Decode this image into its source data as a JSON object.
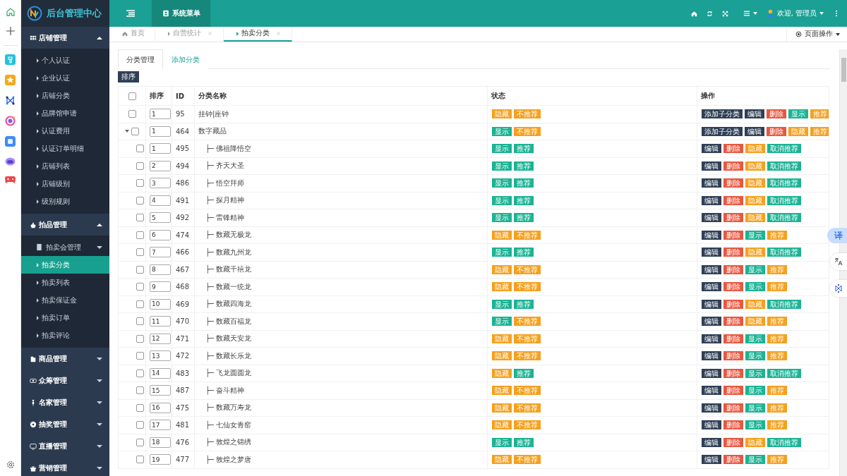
{
  "brand": {
    "title": "后台管理中心"
  },
  "topbar": {
    "menu_tab": "系统菜单",
    "user": "欢迎, 管理员"
  },
  "page_tabs": [
    {
      "label": "首页",
      "selected": false,
      "closable": false
    },
    {
      "label": "自营统计",
      "selected": false,
      "closable": true
    },
    {
      "label": "拍卖分类",
      "selected": true,
      "closable": true
    }
  ],
  "page_actions": "页面操作",
  "sidebar": {
    "groups": [
      {
        "label": "店铺管理",
        "expanded": true,
        "children": [
          {
            "label": "个人认证",
            "selected": false
          },
          {
            "label": "企业认证",
            "selected": false
          },
          {
            "label": "店铺分类",
            "selected": false
          },
          {
            "label": "品牌馆申请",
            "selected": false
          },
          {
            "label": "认证费用",
            "selected": false
          },
          {
            "label": "认证订单明细",
            "selected": false
          },
          {
            "label": "店铺列表",
            "selected": false
          },
          {
            "label": "店铺级别",
            "selected": false
          },
          {
            "label": "级别规则",
            "selected": false
          }
        ]
      },
      {
        "label": "拍品管理",
        "expanded": true,
        "children": [
          {
            "label": "拍卖会管理",
            "expanded": true,
            "children": [
              {
                "label": "拍卖分类",
                "selected": true
              },
              {
                "label": "拍卖列表",
                "selected": false
              },
              {
                "label": "拍卖保证金",
                "selected": false
              },
              {
                "label": "拍卖订单",
                "selected": false
              },
              {
                "label": "拍卖评论",
                "selected": false
              }
            ]
          }
        ]
      },
      {
        "label": "商品管理",
        "expanded": false
      },
      {
        "label": "众筹管理",
        "expanded": false
      },
      {
        "label": "名家管理",
        "expanded": false
      },
      {
        "label": "抽奖管理",
        "expanded": false
      },
      {
        "label": "直播管理",
        "expanded": false
      },
      {
        "label": "营销管理",
        "expanded": false
      }
    ]
  },
  "content": {
    "tabs": [
      {
        "label": "分类管理",
        "selected": true
      },
      {
        "label": "添加分类",
        "selected": false
      }
    ],
    "sort_button": "排序",
    "table": {
      "columns": [
        "排序",
        "ID",
        "分类名称",
        "状态",
        "操作"
      ],
      "select_all": {
        "checked": false
      },
      "rows": [
        {
          "checked": false,
          "sort": "1",
          "id": "95",
          "name": "挂钟|座钟",
          "status": [
            {
              "label": "隐藏",
              "kind": "warning"
            },
            {
              "label": "不推荐",
              "kind": "warning"
            }
          ],
          "actions": [
            {
              "label": "添加子分类",
              "kind": "dark"
            },
            {
              "label": "编辑",
              "kind": "dark"
            },
            {
              "label": "删除",
              "kind": "danger"
            },
            {
              "label": "显示",
              "kind": "success"
            },
            {
              "label": "推荐",
              "kind": "warning"
            }
          ]
        },
        {
          "checked": false,
          "sort": "1",
          "id": "464",
          "name": "数字藏品",
          "expanded": true,
          "status": [
            {
              "label": "显示",
              "kind": "success"
            },
            {
              "label": "不推荐",
              "kind": "warning"
            }
          ],
          "actions": [
            {
              "label": "添加子分类",
              "kind": "dark"
            },
            {
              "label": "编辑",
              "kind": "dark"
            },
            {
              "label": "删除",
              "kind": "danger"
            },
            {
              "label": "隐藏",
              "kind": "warning"
            },
            {
              "label": "推荐",
              "kind": "warning"
            }
          ],
          "children": [
            {
              "checked": false,
              "sort": "1",
              "id": "495",
              "name": "├─ 佛祖降悟空",
              "status": [
                {
                  "label": "显示",
                  "kind": "success"
                },
                {
                  "label": "推荐",
                  "kind": "success"
                }
              ],
              "actions": [
                {
                  "label": "编辑",
                  "kind": "dark"
                },
                {
                  "label": "删除",
                  "kind": "danger"
                },
                {
                  "label": "隐藏",
                  "kind": "warning"
                },
                {
                  "label": "取消推荐",
                  "kind": "success"
                }
              ]
            },
            {
              "checked": false,
              "sort": "2",
              "id": "494",
              "name": "├─ 齐天大圣",
              "status": [
                {
                  "label": "显示",
                  "kind": "success"
                },
                {
                  "label": "推荐",
                  "kind": "success"
                }
              ],
              "actions": [
                {
                  "label": "编辑",
                  "kind": "dark"
                },
                {
                  "label": "删除",
                  "kind": "danger"
                },
                {
                  "label": "隐藏",
                  "kind": "warning"
                },
                {
                  "label": "取消推荐",
                  "kind": "success"
                }
              ]
            },
            {
              "checked": false,
              "sort": "3",
              "id": "486",
              "name": "├─ 悟空拜师",
              "status": [
                {
                  "label": "显示",
                  "kind": "success"
                },
                {
                  "label": "推荐",
                  "kind": "success"
                }
              ],
              "actions": [
                {
                  "label": "编辑",
                  "kind": "dark"
                },
                {
                  "label": "删除",
                  "kind": "danger"
                },
                {
                  "label": "隐藏",
                  "kind": "warning"
                },
                {
                  "label": "取消推荐",
                  "kind": "success"
                }
              ]
            },
            {
              "checked": false,
              "sort": "4",
              "id": "491",
              "name": "├─ 探月精神",
              "status": [
                {
                  "label": "显示",
                  "kind": "success"
                },
                {
                  "label": "推荐",
                  "kind": "success"
                }
              ],
              "actions": [
                {
                  "label": "编辑",
                  "kind": "dark"
                },
                {
                  "label": "删除",
                  "kind": "danger"
                },
                {
                  "label": "隐藏",
                  "kind": "warning"
                },
                {
                  "label": "取消推荐",
                  "kind": "success"
                }
              ]
            },
            {
              "checked": false,
              "sort": "5",
              "id": "492",
              "name": "├─ 雷锋精神",
              "status": [
                {
                  "label": "显示",
                  "kind": "success"
                },
                {
                  "label": "推荐",
                  "kind": "success"
                }
              ],
              "actions": [
                {
                  "label": "编辑",
                  "kind": "dark"
                },
                {
                  "label": "删除",
                  "kind": "danger"
                },
                {
                  "label": "隐藏",
                  "kind": "warning"
                },
                {
                  "label": "取消推荐",
                  "kind": "success"
                }
              ]
            },
            {
              "checked": false,
              "sort": "6",
              "id": "474",
              "name": "├─ 数藏无极龙",
              "status": [
                {
                  "label": "隐藏",
                  "kind": "warning"
                },
                {
                  "label": "不推荐",
                  "kind": "warning"
                }
              ],
              "actions": [
                {
                  "label": "编辑",
                  "kind": "dark"
                },
                {
                  "label": "删除",
                  "kind": "danger"
                },
                {
                  "label": "显示",
                  "kind": "success"
                },
                {
                  "label": "推荐",
                  "kind": "warning"
                }
              ]
            },
            {
              "checked": false,
              "sort": "7",
              "id": "466",
              "name": "├─ 数藏九州龙",
              "status": [
                {
                  "label": "显示",
                  "kind": "success"
                },
                {
                  "label": "推荐",
                  "kind": "success"
                }
              ],
              "actions": [
                {
                  "label": "编辑",
                  "kind": "dark"
                },
                {
                  "label": "删除",
                  "kind": "danger"
                },
                {
                  "label": "隐藏",
                  "kind": "warning"
                },
                {
                  "label": "取消推荐",
                  "kind": "success"
                }
              ]
            },
            {
              "checked": false,
              "sort": "8",
              "id": "467",
              "name": "├─ 数藏千禧龙",
              "status": [
                {
                  "label": "隐藏",
                  "kind": "warning"
                },
                {
                  "label": "不推荐",
                  "kind": "warning"
                }
              ],
              "actions": [
                {
                  "label": "编辑",
                  "kind": "dark"
                },
                {
                  "label": "删除",
                  "kind": "danger"
                },
                {
                  "label": "显示",
                  "kind": "success"
                },
                {
                  "label": "推荐",
                  "kind": "warning"
                }
              ]
            },
            {
              "checked": false,
              "sort": "9",
              "id": "468",
              "name": "├─ 数藏一统龙",
              "status": [
                {
                  "label": "隐藏",
                  "kind": "warning"
                },
                {
                  "label": "不推荐",
                  "kind": "warning"
                }
              ],
              "actions": [
                {
                  "label": "编辑",
                  "kind": "dark"
                },
                {
                  "label": "删除",
                  "kind": "danger"
                },
                {
                  "label": "显示",
                  "kind": "success"
                },
                {
                  "label": "推荐",
                  "kind": "warning"
                }
              ]
            },
            {
              "checked": false,
              "sort": "10",
              "id": "469",
              "name": "├─ 数藏四海龙",
              "status": [
                {
                  "label": "显示",
                  "kind": "success"
                },
                {
                  "label": "推荐",
                  "kind": "success"
                }
              ],
              "actions": [
                {
                  "label": "编辑",
                  "kind": "dark"
                },
                {
                  "label": "删除",
                  "kind": "danger"
                },
                {
                  "label": "隐藏",
                  "kind": "warning"
                },
                {
                  "label": "取消推荐",
                  "kind": "success"
                }
              ]
            },
            {
              "checked": false,
              "sort": "11",
              "id": "470",
              "name": "├─ 数藏百福龙",
              "status": [
                {
                  "label": "显示",
                  "kind": "success"
                },
                {
                  "label": "不推荐",
                  "kind": "warning"
                }
              ],
              "actions": [
                {
                  "label": "编辑",
                  "kind": "dark"
                },
                {
                  "label": "删除",
                  "kind": "danger"
                },
                {
                  "label": "隐藏",
                  "kind": "warning"
                },
                {
                  "label": "推荐",
                  "kind": "warning"
                }
              ]
            },
            {
              "checked": false,
              "sort": "12",
              "id": "471",
              "name": "├─ 数藏天安龙",
              "status": [
                {
                  "label": "隐藏",
                  "kind": "warning"
                },
                {
                  "label": "不推荐",
                  "kind": "warning"
                }
              ],
              "actions": [
                {
                  "label": "编辑",
                  "kind": "dark"
                },
                {
                  "label": "删除",
                  "kind": "danger"
                },
                {
                  "label": "显示",
                  "kind": "success"
                },
                {
                  "label": "推荐",
                  "kind": "warning"
                }
              ]
            },
            {
              "checked": false,
              "sort": "13",
              "id": "472",
              "name": "├─ 数藏长乐龙",
              "status": [
                {
                  "label": "隐藏",
                  "kind": "warning"
                },
                {
                  "label": "不推荐",
                  "kind": "warning"
                }
              ],
              "actions": [
                {
                  "label": "编辑",
                  "kind": "dark"
                },
                {
                  "label": "删除",
                  "kind": "danger"
                },
                {
                  "label": "显示",
                  "kind": "success"
                },
                {
                  "label": "推荐",
                  "kind": "warning"
                }
              ]
            },
            {
              "checked": false,
              "sort": "14",
              "id": "483",
              "name": "├─ 飞龙圆圆龙",
              "status": [
                {
                  "label": "隐藏",
                  "kind": "warning"
                },
                {
                  "label": "推荐",
                  "kind": "success"
                }
              ],
              "actions": [
                {
                  "label": "编辑",
                  "kind": "dark"
                },
                {
                  "label": "删除",
                  "kind": "danger"
                },
                {
                  "label": "显示",
                  "kind": "success"
                },
                {
                  "label": "取消推荐",
                  "kind": "success"
                }
              ]
            },
            {
              "checked": false,
              "sort": "15",
              "id": "487",
              "name": "├─ 奋斗精神",
              "status": [
                {
                  "label": "隐藏",
                  "kind": "warning"
                },
                {
                  "label": "不推荐",
                  "kind": "warning"
                }
              ],
              "actions": [
                {
                  "label": "编辑",
                  "kind": "dark"
                },
                {
                  "label": "删除",
                  "kind": "danger"
                },
                {
                  "label": "显示",
                  "kind": "success"
                },
                {
                  "label": "推荐",
                  "kind": "warning"
                }
              ]
            },
            {
              "checked": false,
              "sort": "16",
              "id": "475",
              "name": "├─ 数藏万寿龙",
              "status": [
                {
                  "label": "隐藏",
                  "kind": "warning"
                },
                {
                  "label": "不推荐",
                  "kind": "warning"
                }
              ],
              "actions": [
                {
                  "label": "编辑",
                  "kind": "dark"
                },
                {
                  "label": "删除",
                  "kind": "danger"
                },
                {
                  "label": "显示",
                  "kind": "success"
                },
                {
                  "label": "推荐",
                  "kind": "warning"
                }
              ]
            },
            {
              "checked": false,
              "sort": "17",
              "id": "481",
              "name": "├─ 七仙女青窑",
              "status": [
                {
                  "label": "隐藏",
                  "kind": "warning"
                },
                {
                  "label": "不推荐",
                  "kind": "warning"
                }
              ],
              "actions": [
                {
                  "label": "编辑",
                  "kind": "dark"
                },
                {
                  "label": "删除",
                  "kind": "danger"
                },
                {
                  "label": "显示",
                  "kind": "success"
                },
                {
                  "label": "推荐",
                  "kind": "warning"
                }
              ]
            },
            {
              "checked": false,
              "sort": "18",
              "id": "476",
              "name": "├─ 敦煌之锦绣",
              "status": [
                {
                  "label": "显示",
                  "kind": "success"
                },
                {
                  "label": "推荐",
                  "kind": "success"
                }
              ],
              "actions": [
                {
                  "label": "编辑",
                  "kind": "dark"
                },
                {
                  "label": "删除",
                  "kind": "danger"
                },
                {
                  "label": "隐藏",
                  "kind": "warning"
                },
                {
                  "label": "取消推荐",
                  "kind": "success"
                }
              ]
            },
            {
              "checked": false,
              "sort": "19",
              "id": "477",
              "name": "├─ 敦煌之梦唐",
              "status": [
                {
                  "label": "隐藏",
                  "kind": "warning"
                },
                {
                  "label": "不推荐",
                  "kind": "warning"
                }
              ],
              "actions": [
                {
                  "label": "编辑",
                  "kind": "dark"
                },
                {
                  "label": "删除",
                  "kind": "danger"
                },
                {
                  "label": "显示",
                  "kind": "success"
                },
                {
                  "label": "推荐",
                  "kind": "warning"
                }
              ]
            }
          ]
        }
      ]
    }
  },
  "float_tools": {
    "translate": "译"
  }
}
